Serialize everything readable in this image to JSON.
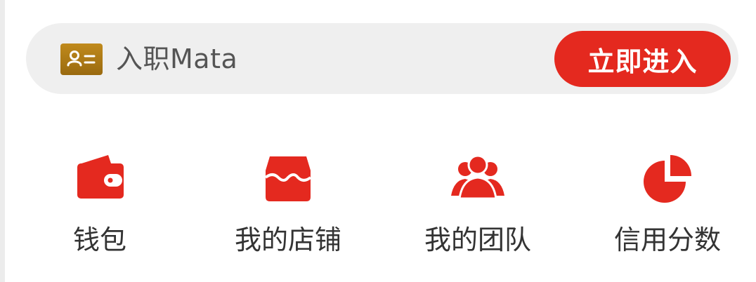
{
  "banner": {
    "label": "入职Mata",
    "button_label": "立即进入",
    "badge_icon": "id-card-icon"
  },
  "menu": {
    "items": [
      {
        "label": "钱包",
        "icon": "wallet-icon"
      },
      {
        "label": "我的店铺",
        "icon": "store-icon"
      },
      {
        "label": "我的团队",
        "icon": "team-icon"
      },
      {
        "label": "信用分数",
        "icon": "pie-chart-icon"
      }
    ]
  },
  "colors": {
    "accent": "#e4291f",
    "banner_bg": "#efefef",
    "badge": "#a8741a",
    "text": "#333333"
  }
}
